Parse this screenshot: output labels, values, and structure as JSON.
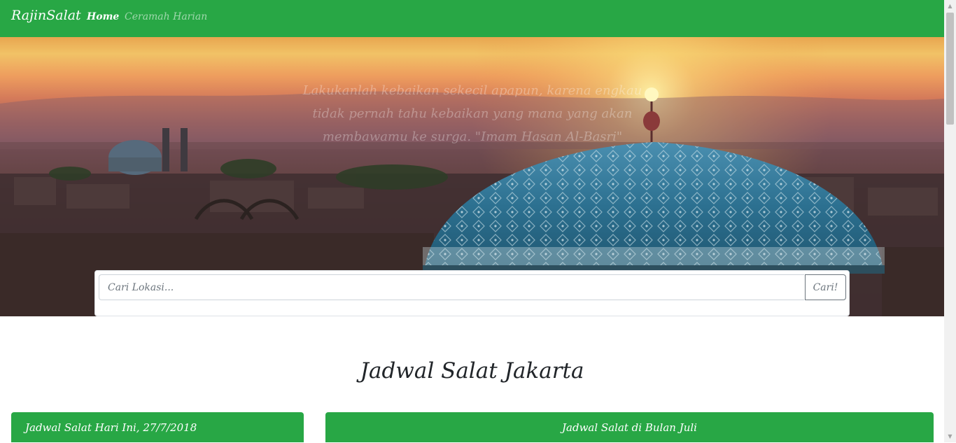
{
  "navbar": {
    "brand": "RajinSalat",
    "links": [
      {
        "label": "Home",
        "active": true
      },
      {
        "label": "Ceramah Harian",
        "active": false
      }
    ],
    "color": "#28a745"
  },
  "hero": {
    "quote": "Lakukanlah kebaikan sekecil apapun, karena engkau tidak pernah tahu kebaikan yang mana yang akan membawamu ke surga. \"Imam Hasan Al-Basri\""
  },
  "search": {
    "placeholder": "Cari Lokasi...",
    "value": "",
    "button_label": "Cari!"
  },
  "section_title": "Jadwal Salat Jakarta",
  "cards": {
    "today_header": "Jadwal Salat Hari Ini, 27/7/2018",
    "month_header": "Jadwal Salat di Bulan Juli"
  },
  "icons": [
    "scroll-up-icon",
    "scroll-down-icon"
  ]
}
